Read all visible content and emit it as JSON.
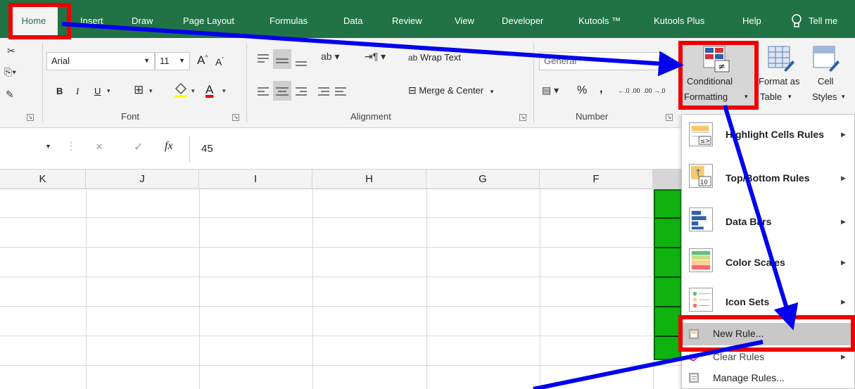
{
  "tabs": [
    {
      "label": "Home",
      "active": true
    },
    {
      "label": "Insert"
    },
    {
      "label": "Draw"
    },
    {
      "label": "Page Layout"
    },
    {
      "label": "Formulas"
    },
    {
      "label": "Data"
    },
    {
      "label": "Review"
    },
    {
      "label": "View"
    },
    {
      "label": "Developer"
    },
    {
      "label": "Kutools ™"
    },
    {
      "label": "Kutools Plus"
    },
    {
      "label": "Help"
    },
    {
      "label": "Tell me"
    }
  ],
  "ribbon": {
    "font": {
      "name": "Arial",
      "size": "11",
      "bold": "B",
      "italic": "I",
      "underline": "U",
      "increase": "A",
      "decrease": "A",
      "font_color_letter": "A",
      "group_label": "Font"
    },
    "alignment": {
      "wrap_text": "Wrap Text",
      "wrap_icon_text": "ab",
      "merge_center": "Merge & Center",
      "group_label": "Alignment"
    },
    "number": {
      "format": "General",
      "percent": "%",
      "comma": ",",
      "inc_decimal": "←.0 .00",
      "dec_decimal": ".00 →.0",
      "group_label": "Number"
    },
    "styles": {
      "conditional_formatting_line1": "Conditional",
      "conditional_formatting_line2": "Formatting",
      "format_as_table_line1": "Format as",
      "format_as_table_line2": "Table",
      "cell_styles_line1": "Cell",
      "cell_styles_line2": "Styles"
    }
  },
  "formula_bar": {
    "fx": "fx",
    "cancel": "×",
    "enter": "✓",
    "value": "45"
  },
  "columns": [
    "K",
    "J",
    "I",
    "H",
    "G",
    "F"
  ],
  "menu": {
    "items": [
      {
        "label": "Highlight Cells Rules",
        "submenu": true
      },
      {
        "label": "Top/Bottom Rules",
        "submenu": true
      },
      {
        "label": "Data Bars",
        "submenu": true
      },
      {
        "label": "Color Scales",
        "submenu": true
      },
      {
        "label": "Icon Sets",
        "submenu": true
      }
    ],
    "new_rule": "New Rule...",
    "clear_rules": "Clear Rules",
    "manage_rules": "Manage Rules..."
  },
  "colors": {
    "ribbon_green": "#217346",
    "highlight_red": "#ee0000",
    "arrow_blue": "#0000ee",
    "cell_green": "#0fb20f"
  }
}
